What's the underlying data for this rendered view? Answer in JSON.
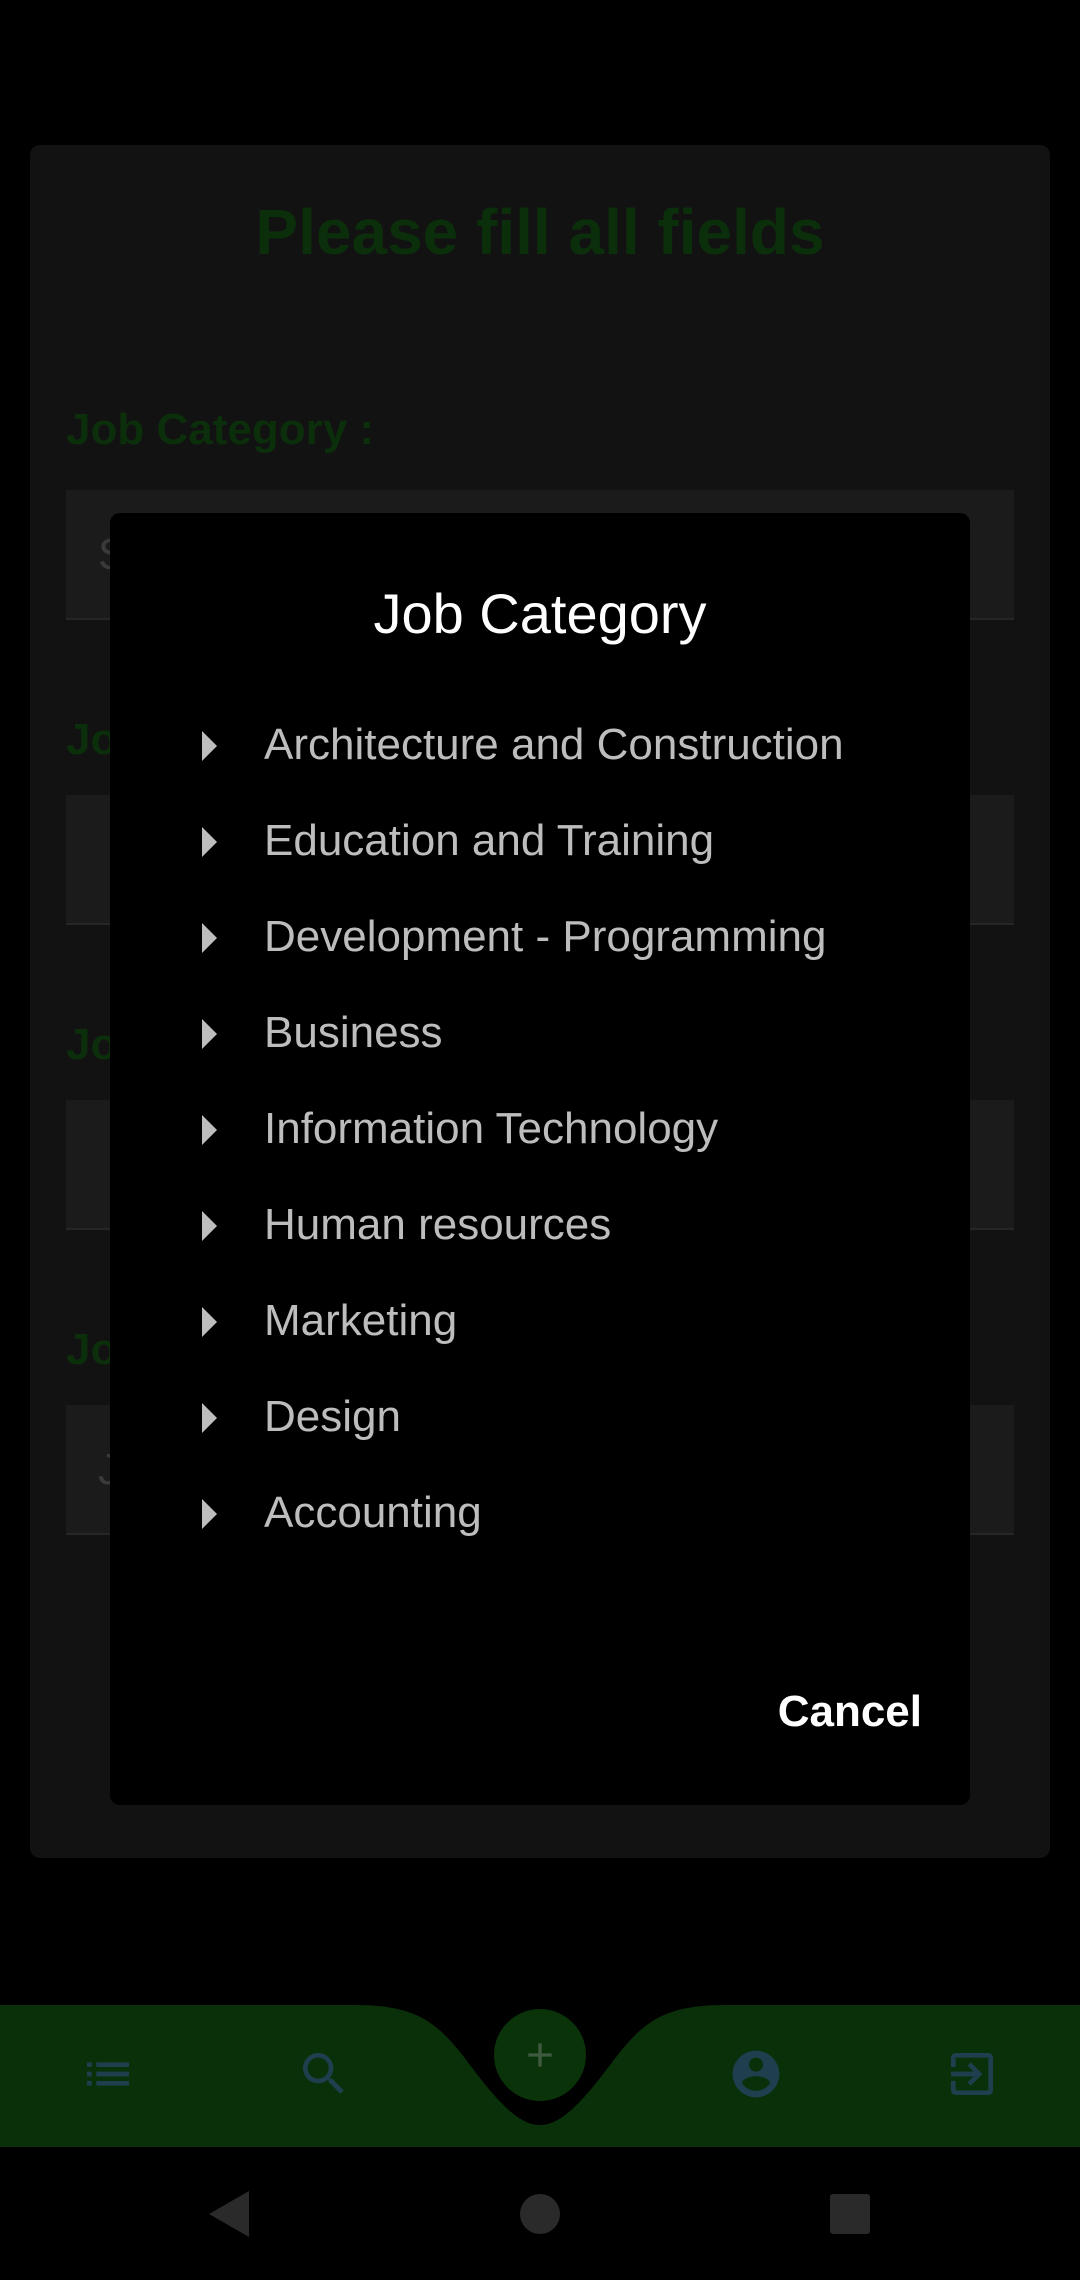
{
  "form": {
    "title": "Please fill all fields",
    "fields": [
      {
        "label": "Job Category :",
        "value": "S"
      },
      {
        "label": "Jo",
        "value": ""
      },
      {
        "label": "Jo",
        "value": ""
      },
      {
        "label": "Jo",
        "value": "J"
      }
    ]
  },
  "dialog": {
    "title": "Job Category",
    "categories": [
      "Architecture and Construction",
      "Education and Training",
      "Development - Programming",
      "Business",
      "Information Technology",
      "Human resources",
      "Marketing",
      "Design",
      "Accounting"
    ],
    "cancel_label": "Cancel"
  },
  "bottom_nav": {
    "items": [
      "list-icon",
      "search-icon",
      "add-icon",
      "account-icon",
      "logout-icon"
    ],
    "bar_color": "#0a300a"
  },
  "system_nav": {
    "items": [
      "back-icon",
      "home-icon",
      "recents-icon"
    ]
  }
}
